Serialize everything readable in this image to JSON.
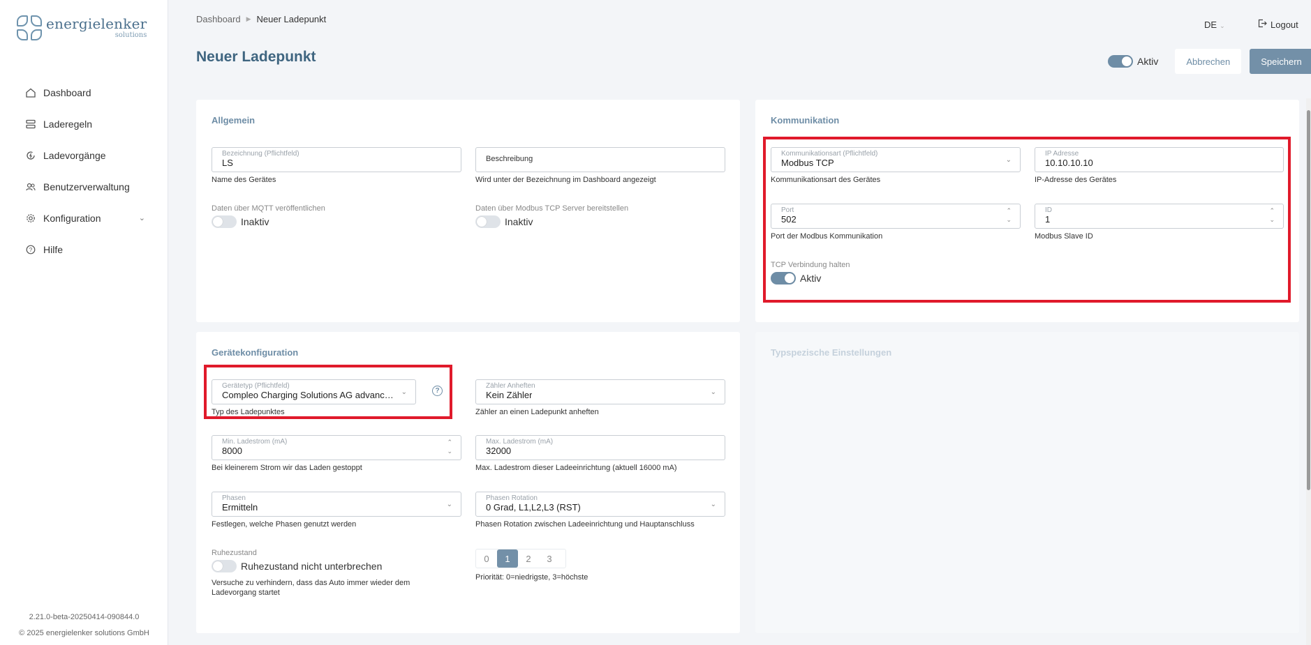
{
  "brand": {
    "name": "energielenker",
    "sub": "solutions"
  },
  "nav": {
    "items": [
      {
        "label": "Dashboard"
      },
      {
        "label": "Laderegeln"
      },
      {
        "label": "Ladevorgänge"
      },
      {
        "label": "Benutzerverwaltung"
      },
      {
        "label": "Konfiguration"
      },
      {
        "label": "Hilfe"
      }
    ]
  },
  "footer": {
    "version": "2.21.0-beta-20250414-090844.0",
    "copyright": "© 2025 energielenker solutions GmbH"
  },
  "header": {
    "breadcrumb": {
      "root": "Dashboard",
      "current": "Neuer Ladepunkt"
    },
    "title": "Neuer Ladepunkt",
    "lang": "DE",
    "logout": "Logout",
    "active_label": "Aktiv",
    "active_state": true,
    "cancel": "Abbrechen",
    "save": "Speichern"
  },
  "allgemein": {
    "title": "Allgemein",
    "bezeichnung": {
      "label": "Bezeichnung (Pflichtfeld)",
      "value": "LS",
      "hint": "Name des Gerätes"
    },
    "beschreibung": {
      "placeholder": "Beschreibung",
      "hint": "Wird unter der Bezeichnung im Dashboard angezeigt"
    },
    "mqtt": {
      "label": "Daten über MQTT veröffentlichen",
      "state": "Inaktiv"
    },
    "modbus_server": {
      "label": "Daten über Modbus TCP Server bereitstellen",
      "state": "Inaktiv"
    }
  },
  "kommunikation": {
    "title": "Kommunikation",
    "art": {
      "label": "Kommunikationsart (Pflichtfeld)",
      "value": "Modbus TCP",
      "hint": "Kommunikationsart des Gerätes"
    },
    "ip": {
      "label": "IP Adresse",
      "value": "10.10.10.10",
      "hint": "IP-Adresse des Gerätes"
    },
    "port": {
      "label": "Port",
      "value": "502",
      "hint": "Port der Modbus Kommunikation"
    },
    "id": {
      "label": "ID",
      "value": "1",
      "hint": "Modbus Slave ID"
    },
    "tcp_keep": {
      "label": "TCP Verbindung halten",
      "state": "Aktiv"
    }
  },
  "geraet": {
    "title": "Gerätekonfiguration",
    "typ": {
      "label": "Gerätetyp (Pflichtfeld)",
      "value": "Compleo Charging Solutions AG advanced (...",
      "hint": "Typ des Ladepunktes"
    },
    "zaehler": {
      "label": "Zähler Anheften",
      "value": "Kein Zähler",
      "hint": "Zähler an einen Ladepunkt anheften"
    },
    "min_strom": {
      "label": "Min. Ladestrom (mA)",
      "value": "8000",
      "hint": "Bei kleinerem Strom wir das Laden gestoppt"
    },
    "max_strom": {
      "label": "Max. Ladestrom (mA)",
      "value": "32000",
      "hint": "Max. Ladestrom dieser Ladeeinrichtung (aktuell 16000 mA)"
    },
    "phasen": {
      "label": "Phasen",
      "value": "Ermitteln",
      "hint": "Festlegen, welche Phasen genutzt werden"
    },
    "rotation": {
      "label": "Phasen Rotation",
      "value": "0 Grad, L1,L2,L3 (RST)",
      "hint": "Phasen Rotation zwischen Ladeeinrichtung und Hauptanschluss"
    },
    "ruhe": {
      "label": "Ruhezustand",
      "state": "Ruhezustand nicht unterbrechen",
      "hint": "Versuche zu verhindern, dass das Auto immer wieder dem Ladevorgang startet"
    },
    "prio": {
      "options": [
        "0",
        "1",
        "2",
        "3"
      ],
      "selected": "1",
      "hint": "Priorität: 0=niedrigste, 3=höchste"
    }
  },
  "typ_settings": {
    "title": "Typspezische Einstellungen"
  },
  "icons": {
    "dashboard": "home-icon",
    "laderegeln": "rules-icon",
    "ladevorgaenge": "charging-cycle-icon",
    "benutzer": "users-icon",
    "konfiguration": "gear-icon",
    "hilfe": "help-circle-icon",
    "logout": "logout-icon"
  },
  "colors": {
    "accent": "#6e8da6",
    "title": "#3f6580",
    "highlight": "#e01a2b"
  }
}
